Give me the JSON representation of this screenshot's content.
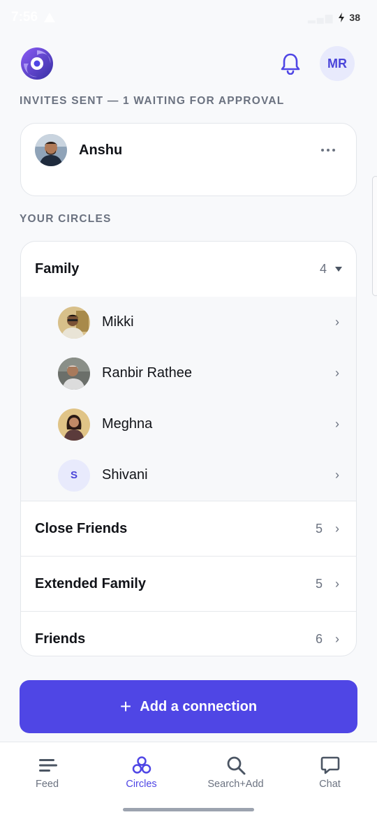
{
  "status_bar": {
    "time": "7:56",
    "battery": "38"
  },
  "header": {
    "logo": "app-logo",
    "user_initials": "MR"
  },
  "invites": {
    "label": "INVITES SENT — 1 WAITING FOR APPROVAL",
    "items": [
      {
        "name": "Anshu"
      }
    ]
  },
  "circles": {
    "label": "YOUR CIRCLES",
    "expanded": {
      "name": "Family",
      "count": "4",
      "members": [
        {
          "name": "Mikki"
        },
        {
          "name": "Ranbir Rathee"
        },
        {
          "name": "Meghna"
        },
        {
          "name": "Shivani",
          "initial": "S"
        }
      ]
    },
    "others": [
      {
        "name": "Close Friends",
        "count": "5"
      },
      {
        "name": "Extended Family",
        "count": "5"
      },
      {
        "name": "Friends",
        "count": "6"
      }
    ]
  },
  "add_button": {
    "plus": "+",
    "label": "Add a connection"
  },
  "tabs": [
    {
      "label": "Feed",
      "icon": "feed-icon"
    },
    {
      "label": "Circles",
      "icon": "circles-icon",
      "active": true
    },
    {
      "label": "Search+Add",
      "icon": "search-icon"
    },
    {
      "label": "Chat",
      "icon": "chat-icon"
    }
  ],
  "colors": {
    "accent": "#4f46e5",
    "avatar_bg": "#e8eafc"
  }
}
